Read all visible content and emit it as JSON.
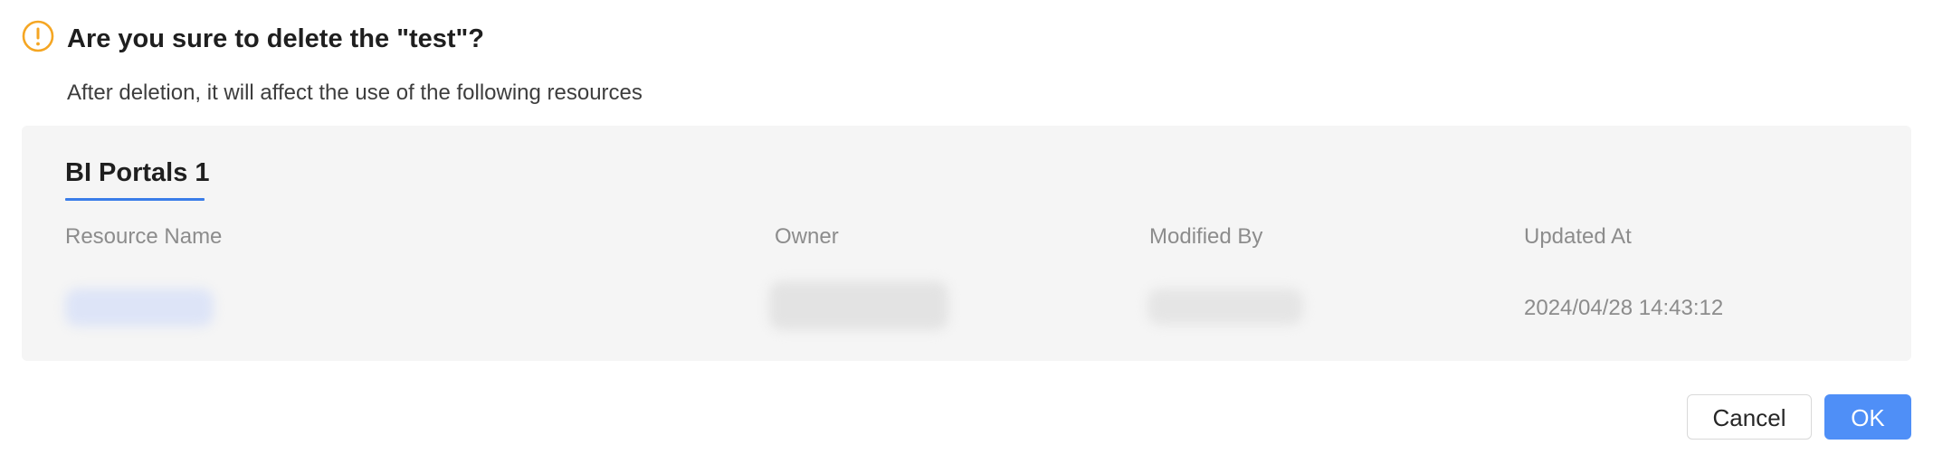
{
  "dialog": {
    "title": "Are you sure to delete the \"test\"?",
    "subtitle": "After deletion, it will affect the use of the following resources",
    "warning_color": "#f5a623"
  },
  "resources": {
    "tab_label": "BI Portals 1",
    "accent_color": "#3a7de8",
    "columns": [
      "Resource Name",
      "Owner",
      "Modified By",
      "Updated At"
    ],
    "rows": [
      {
        "resource_name": "",
        "owner": "",
        "modified_by": "",
        "updated_at": "2024/04/28 14:43:12"
      }
    ]
  },
  "footer": {
    "cancel_label": "Cancel",
    "ok_label": "OK",
    "ok_color": "#4f8ff7"
  }
}
